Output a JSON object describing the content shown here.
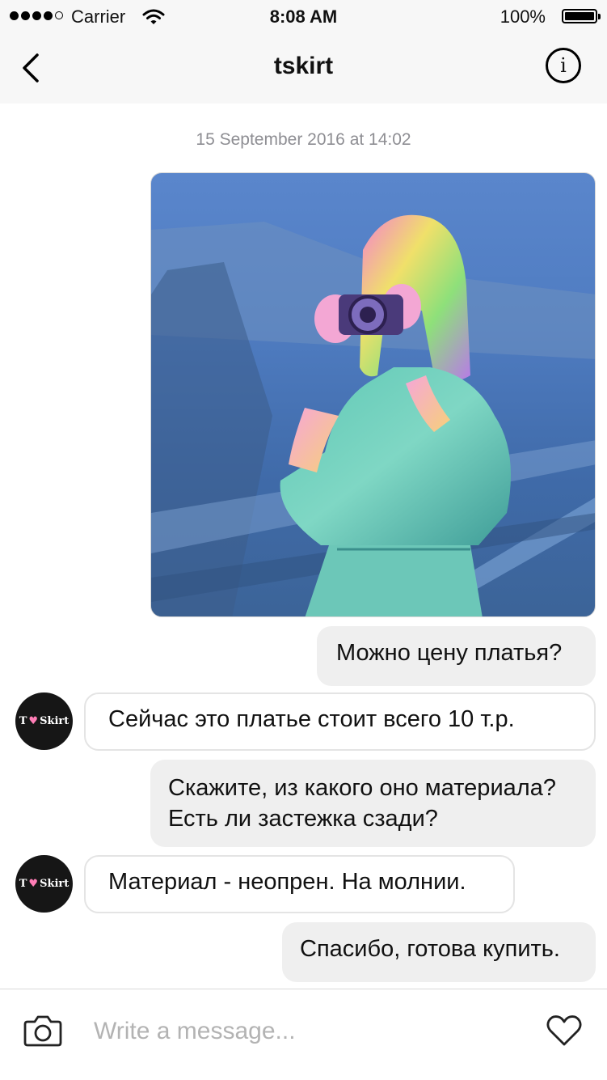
{
  "status_bar": {
    "carrier": "Carrier",
    "time": "8:08 AM",
    "battery": "100%",
    "battery_level": 1.0,
    "signal_bars": 4,
    "icons": [
      "signal-dots-icon",
      "wifi-icon",
      "battery-icon"
    ]
  },
  "nav": {
    "title": "tskirt",
    "back_icon": "chevron-left-icon",
    "info_icon": "info-icon",
    "info_glyph": "i"
  },
  "chat": {
    "timestamp": "15 September 2016 at 14:02",
    "messages": [
      {
        "from": "me",
        "type": "image"
      },
      {
        "from": "me",
        "text": "Можно цену платья?"
      },
      {
        "from": "shop",
        "text": "Сейчас это платье стоит всего 10 т.р."
      },
      {
        "from": "me",
        "text": "Скажите, из какого оно материала?\nЕсть ли застежка сзади?"
      },
      {
        "from": "shop",
        "text": "Материал - неопрен. На молнии."
      },
      {
        "from": "me",
        "text": "Спасибо, готова купить."
      }
    ],
    "avatar": {
      "left": "T",
      "right": "Skirt",
      "heart": "♥"
    }
  },
  "composer": {
    "placeholder": "Write a message...",
    "camera_icon": "camera-icon",
    "like_icon": "heart-icon"
  },
  "colors": {
    "outgoing_bubble": "#efefef",
    "incoming_border": "#e4e4e4",
    "bar_background": "#f7f7f7",
    "timestamp": "#8e8e93",
    "avatar_heart": "#ff7eb6"
  }
}
